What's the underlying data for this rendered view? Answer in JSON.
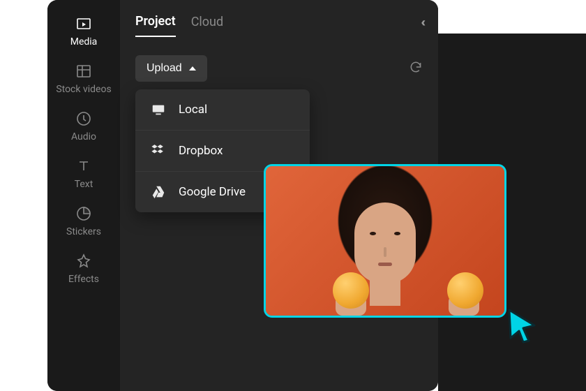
{
  "sidebar": {
    "items": [
      {
        "label": "Media"
      },
      {
        "label": "Stock videos"
      },
      {
        "label": "Audio"
      },
      {
        "label": "Text"
      },
      {
        "label": "Stickers"
      },
      {
        "label": "Effects"
      }
    ]
  },
  "tabs": {
    "project": "Project",
    "cloud": "Cloud"
  },
  "upload": {
    "label": "Upload",
    "options": [
      {
        "label": "Local"
      },
      {
        "label": "Dropbox"
      },
      {
        "label": "Google Drive"
      }
    ]
  },
  "preview": {
    "description": "Person with dark hair holding oranges on orange background"
  },
  "colors": {
    "accent": "#00d4e6"
  }
}
